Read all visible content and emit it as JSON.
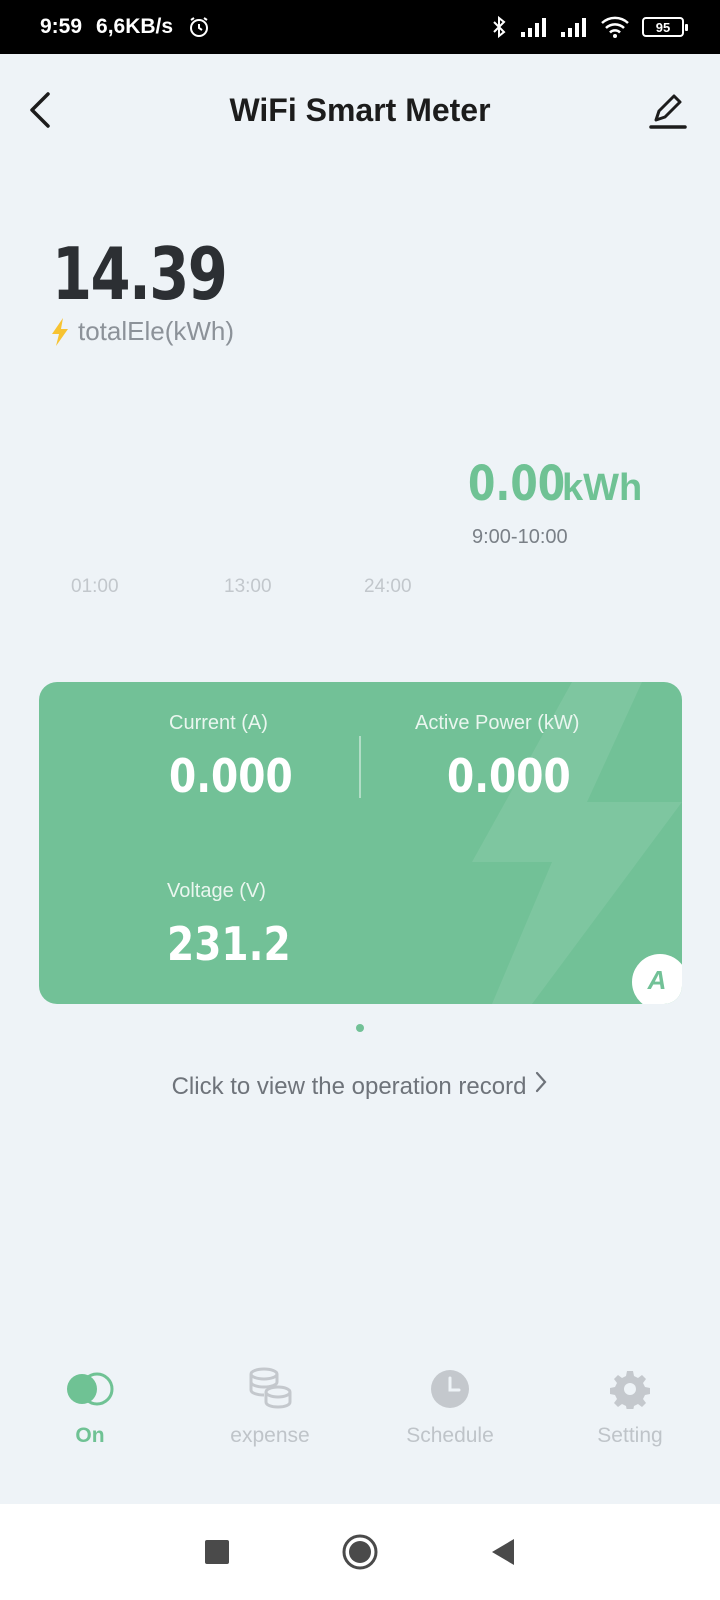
{
  "status_bar": {
    "time": "9:59",
    "speed": "6,6KB/s",
    "battery": "95"
  },
  "header": {
    "title": "WiFi Smart Meter"
  },
  "total": {
    "value": "14.39",
    "label": "totalEle(kWh)"
  },
  "hourly": {
    "value": "0.00",
    "unit": "kWh",
    "range": "9:00-10:00"
  },
  "chart_data": {
    "type": "bar",
    "categories": [
      "01:00",
      "13:00",
      "24:00"
    ],
    "values": [],
    "xlabel": "",
    "ylabel": ""
  },
  "card": {
    "metrics": [
      {
        "label": "Current (A)",
        "value": "0.000"
      },
      {
        "label": "Active Power (kW)",
        "value": "0.000"
      },
      {
        "label": "Voltage (V)",
        "value": "231.2"
      }
    ],
    "badge": "A"
  },
  "record_link": "Click to view the operation record",
  "tabs": [
    {
      "label": "On",
      "icon": "toggle-icon",
      "active": true
    },
    {
      "label": "expense",
      "icon": "coins-icon",
      "active": false
    },
    {
      "label": "Schedule",
      "icon": "clock-icon",
      "active": false
    },
    {
      "label": "Setting",
      "icon": "gear-icon",
      "active": false
    }
  ],
  "colors": {
    "accent": "#72c197",
    "accent_text": "#6fc294",
    "background": "#eef3f7",
    "bolt": "#f7c331"
  }
}
